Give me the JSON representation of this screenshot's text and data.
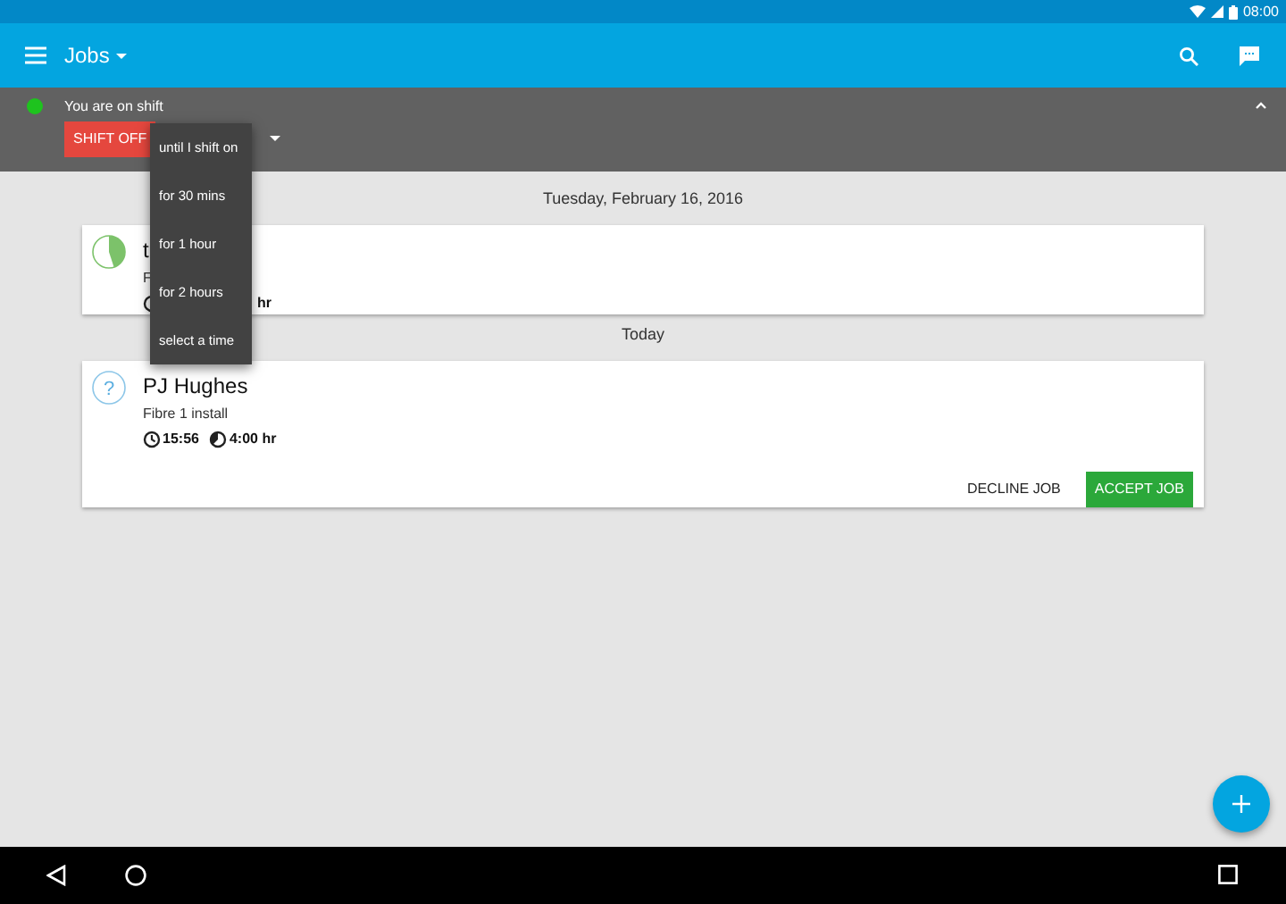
{
  "status_bar": {
    "time": "08:00"
  },
  "app_bar": {
    "title": "Jobs"
  },
  "shift_panel": {
    "status": "You are on shift",
    "on_shift": true,
    "button": "SHIFT OFF"
  },
  "shift_menu": {
    "items": [
      "until I shift on",
      "for 30 mins",
      "for 1 hour",
      "for 2 hours",
      "select a time"
    ]
  },
  "sections": [
    {
      "header": "Tuesday, February 16, 2016",
      "jobs": [
        {
          "kind": "progress",
          "level": 0.45,
          "title": "t",
          "subtitle": "F",
          "duration": "hr"
        }
      ]
    },
    {
      "header": "Today",
      "jobs": [
        {
          "kind": "unknown",
          "icon": "?",
          "title": "PJ Hughes",
          "subtitle": "Fibre 1 install",
          "time": "15:56",
          "duration": "4:00 hr",
          "actions": [
            {
              "label": "DECLINE JOB",
              "primary": false
            },
            {
              "label": "ACCEPT JOB",
              "primary": true
            }
          ]
        }
      ]
    }
  ]
}
